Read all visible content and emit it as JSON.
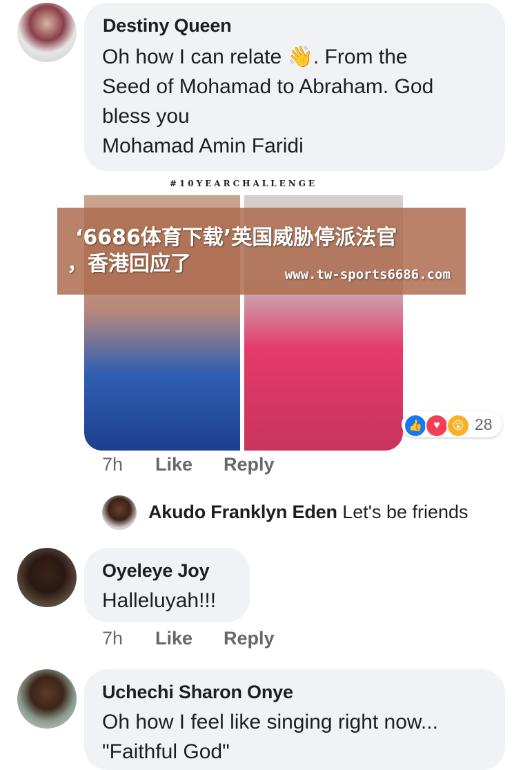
{
  "comments": [
    {
      "author": "Destiny Queen",
      "lines": [
        "Oh how I can relate",
        ". From the",
        "Seed of Mohamad to Abraham. God",
        "bless you",
        "Mohamad Amin Faridi"
      ],
      "emoji": "👋",
      "image_header": "#10YEARCHALLENGE",
      "reaction_count": "28",
      "time": "7h",
      "like_label": "Like",
      "reply_label": "Reply",
      "reply": {
        "author": "Akudo Franklyn Eden",
        "text": "Let's be friends"
      }
    },
    {
      "author": "Oyeleye Joy",
      "text": "Halleluyah!!!",
      "time": "7h",
      "like_label": "Like",
      "reply_label": "Reply"
    },
    {
      "author": "Uchechi Sharon Onye",
      "lines": [
        "Oh how I feel like singing right now...",
        "\"Faithful God\""
      ]
    }
  ],
  "banner": {
    "line1": "‘6686体育下载’英国威胁停派法官",
    "line2": "，香港回应了",
    "url": "www.tw-sports6686.com"
  },
  "colors": {
    "bubble": "#f0f2f5",
    "meta": "#65676b",
    "like_blue": "#1877f2",
    "love_red": "#f33e58",
    "wow_yellow": "#f7b125"
  }
}
